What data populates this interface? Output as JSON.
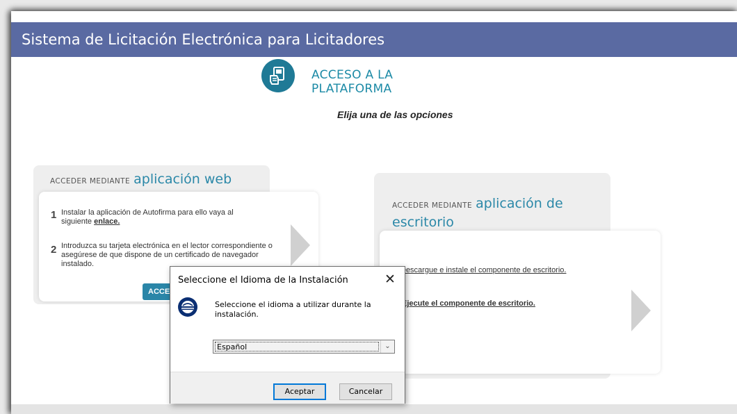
{
  "header": {
    "title": "Sistema de Licitación Electrónica para Licitadores"
  },
  "access": {
    "title_line1": "ACCESO A LA",
    "title_line2": "PLATAFORMA",
    "subtitle": "Elija una de las opciones",
    "icon": "hand-card-icon"
  },
  "web_card": {
    "prefix": "ACCEDER MEDIANTE",
    "name": "aplicación web",
    "step1_num": "1",
    "step1_text": "Instalar la aplicación de Autofirma para ello vaya al siguiente",
    "step1_link": "enlace.",
    "step2_num": "2",
    "step2_text": "Introduzca su tarjeta electrónica en el lector correspondiente o asegúrese de que dispone de un certificado de navegador instalado.",
    "button_label": "ACCEDER"
  },
  "desktop_card": {
    "prefix": "ACCEDER MEDIANTE",
    "name_line1": "aplicación de",
    "name_line2": "escritorio",
    "link1": "Descargue e instale el componente de escritorio.",
    "link2": "Ejecute el componente de escritorio."
  },
  "dialog": {
    "title": "Seleccione el Idioma de la Instalación",
    "close_glyph": "✕",
    "message": "Seleccione el idioma a utilizar durante la instalación.",
    "selected_language": "Español",
    "chevron_glyph": "⌄",
    "ok_label": "Aceptar",
    "cancel_label": "Cancelar"
  },
  "colors": {
    "title_bar": "#5a6aa2",
    "accent": "#1c8aa6",
    "dialog_focus": "#0078d7"
  }
}
